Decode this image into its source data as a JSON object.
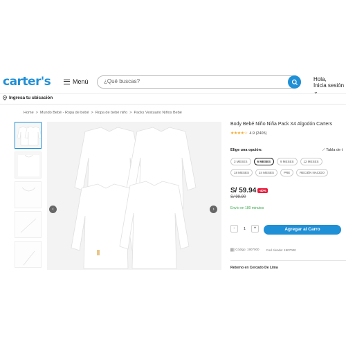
{
  "header": {
    "logo": "carter's",
    "menu_label": "Menú",
    "search_placeholder": "¿Qué buscas?",
    "login_line1": "Hola,",
    "login_line2": "Inicia sesión ⌄"
  },
  "location": {
    "label": "Ingresa tu ubicación"
  },
  "breadcrumb": [
    "Home",
    ">",
    "Mundo Bebé - Ropa de bebé",
    ">",
    "Ropa de bebé niño",
    ">",
    "Packs Vestuario Niños Bebé"
  ],
  "product": {
    "title": "Body Bebé Niño Niña Pack X4 Algodón Carters",
    "stars": "★★★★☆",
    "rating": "4.9 (2405)",
    "option_label": "Elige una opción:",
    "size_guide": "Tabla de t",
    "sizes": [
      "3 MESES",
      "6 MESES",
      "9 MESES",
      "12 MESES",
      "18 MESES",
      "24 MESES",
      "PRE",
      "RECIÉN NACIDO"
    ],
    "selected_size": "6 MESES",
    "price": "S/ 59.94",
    "discount": "-40%",
    "old_price": "S/ 99.90",
    "delivery": "Envío en 180 minutos",
    "quantity": "1",
    "qty_minus": "-",
    "qty_plus": "+",
    "add_to_cart": "Agregar al Carro",
    "code": "Código: 1907000",
    "store_code": "Cod. tienda: 1907000",
    "pickup": "Retorno en Cercado De Lima"
  },
  "colors": {
    "brand": "#1f8fd6",
    "discount": "#e51c3c",
    "delivery": "#3aa84d"
  }
}
